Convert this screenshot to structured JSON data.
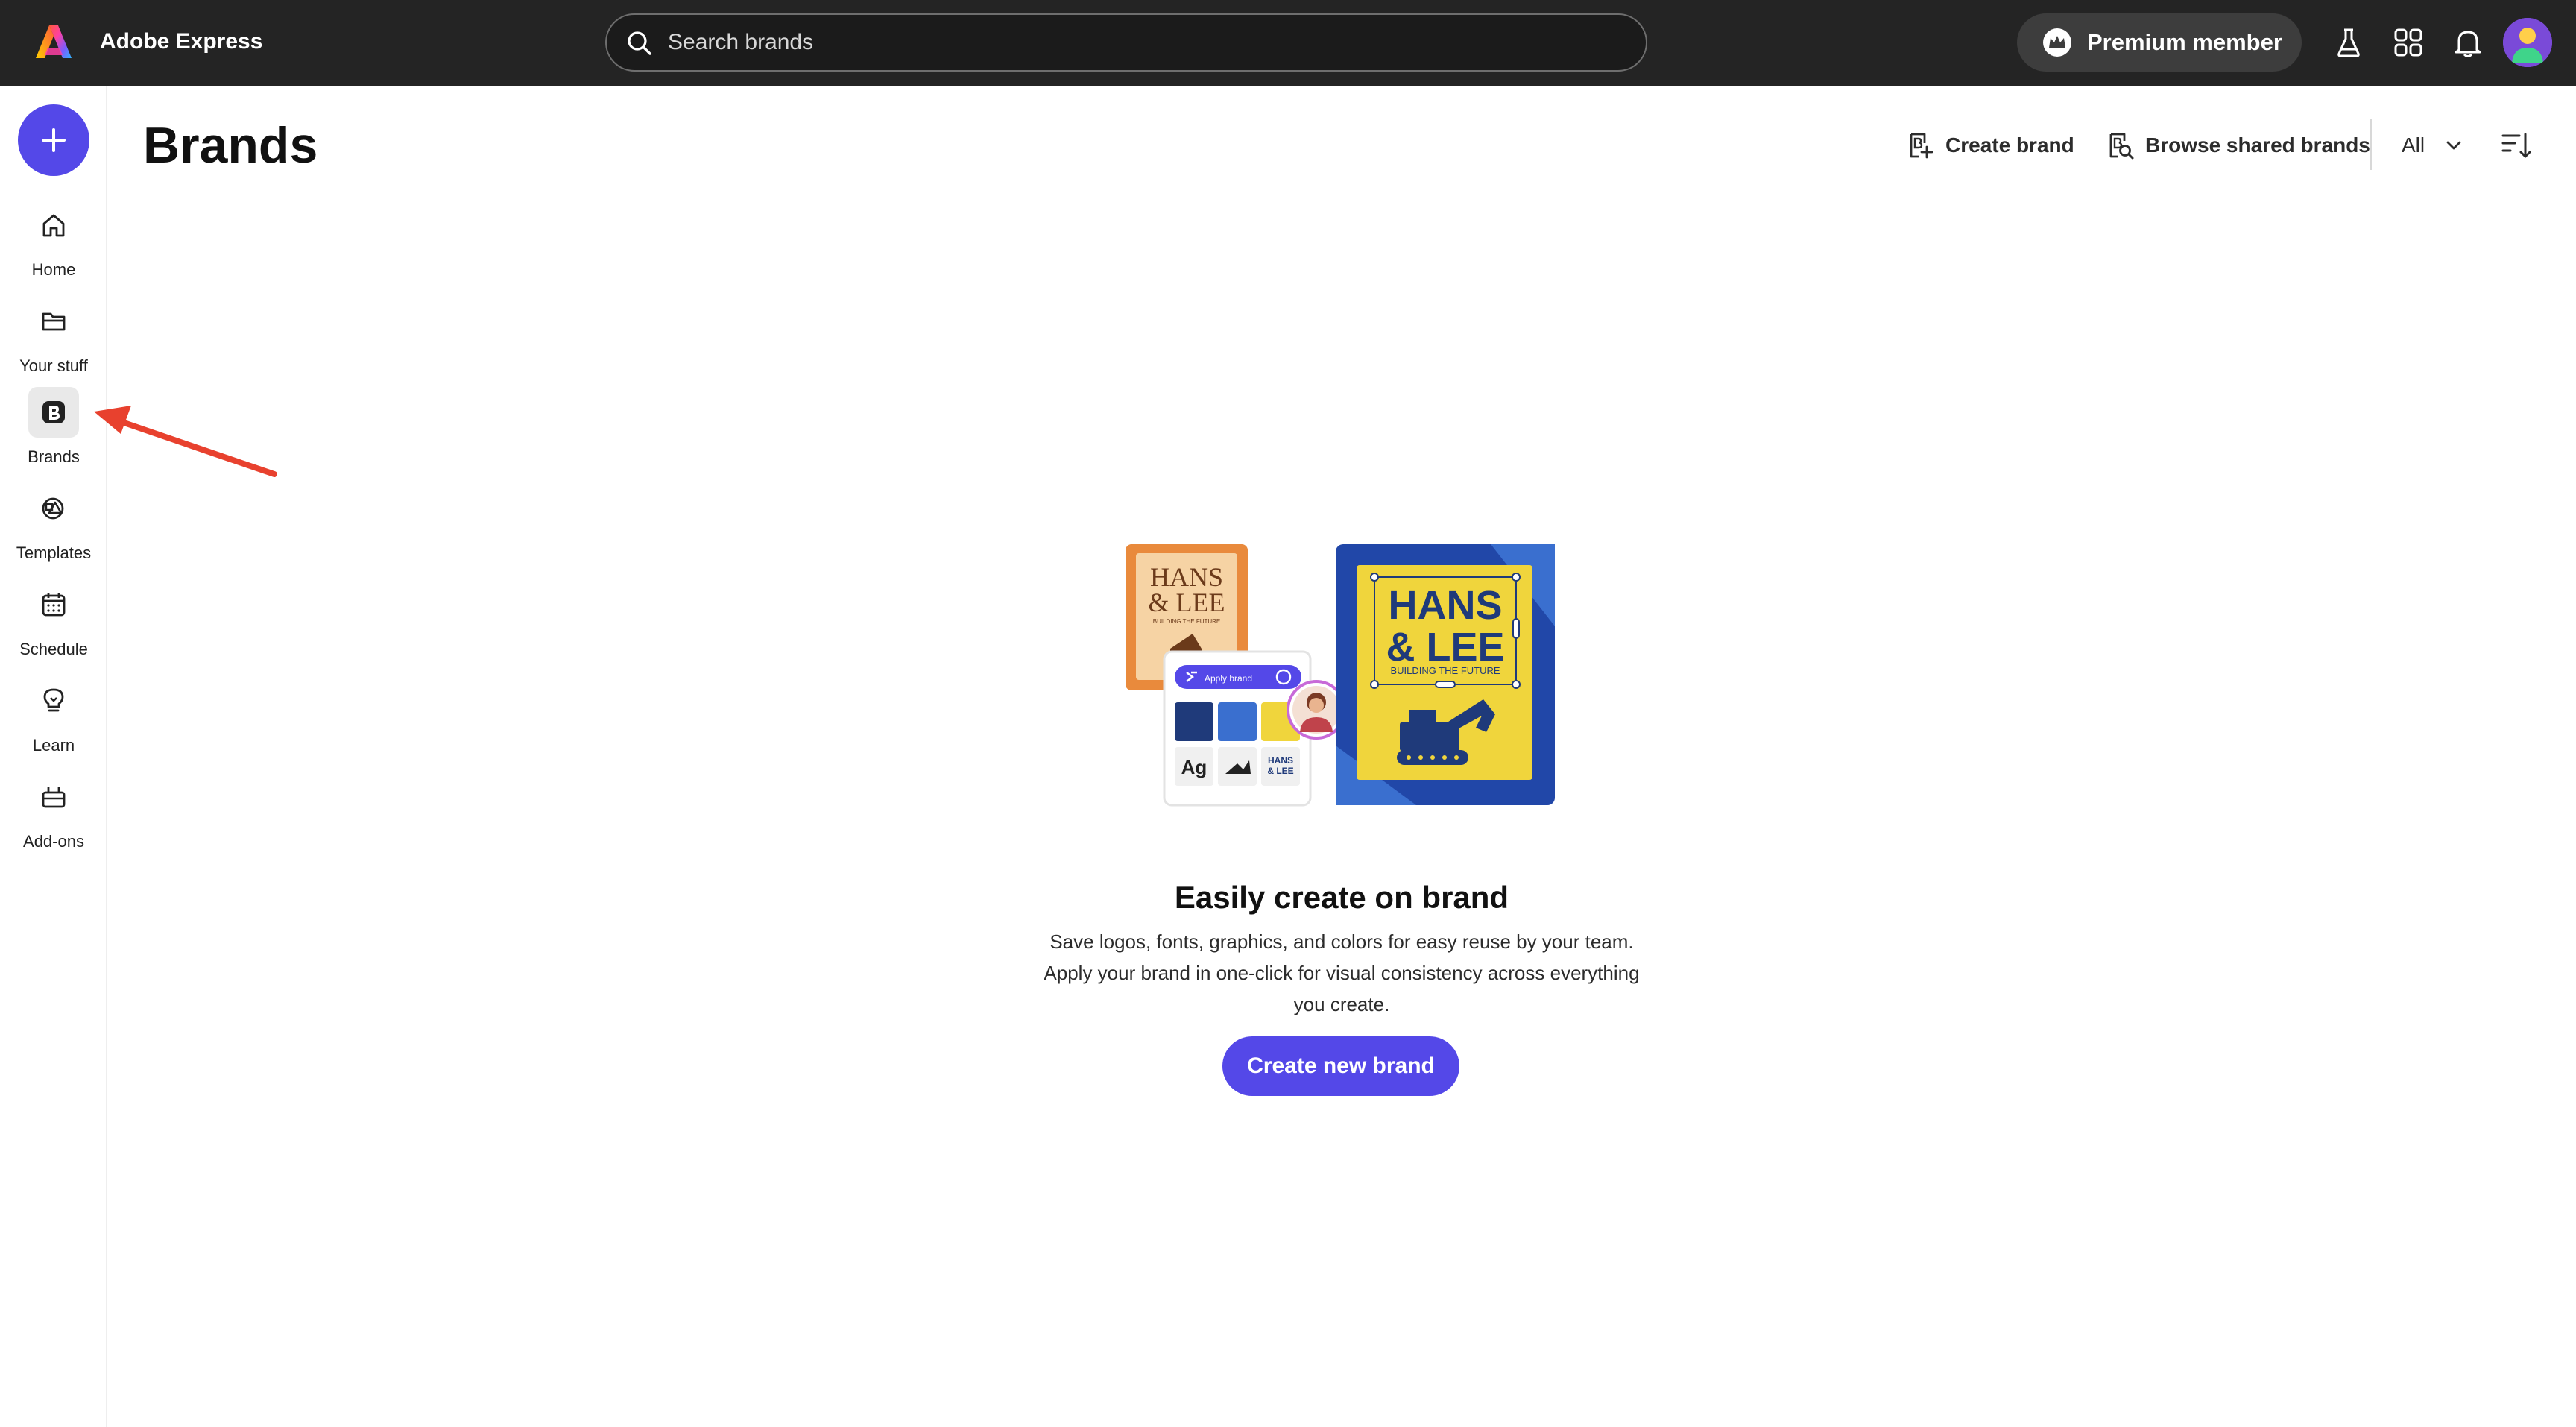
{
  "app": {
    "name": "Adobe Express"
  },
  "search": {
    "placeholder": "Search brands"
  },
  "header": {
    "premium_label": "Premium member",
    "icons": [
      "labs-icon",
      "apps-grid-icon",
      "bell-icon",
      "avatar"
    ]
  },
  "sidebar": {
    "create_icon": "plus-icon",
    "items": [
      {
        "label": "Home",
        "icon": "home-icon",
        "active": false
      },
      {
        "label": "Your stuff",
        "icon": "folder-icon",
        "active": false
      },
      {
        "label": "Brands",
        "icon": "brand-b-icon",
        "active": true
      },
      {
        "label": "Templates",
        "icon": "templates-icon",
        "active": false
      },
      {
        "label": "Schedule",
        "icon": "calendar-icon",
        "active": false
      },
      {
        "label": "Learn",
        "icon": "lightbulb-icon",
        "active": false
      },
      {
        "label": "Add-ons",
        "icon": "addons-icon",
        "active": false
      }
    ]
  },
  "main": {
    "title": "Brands",
    "actions": {
      "create_brand": "Create brand",
      "browse_shared": "Browse shared brands",
      "filter_value": "All"
    },
    "empty_state": {
      "title": "Easily create on brand",
      "description": "Save logos, fonts, graphics, and colors for easy reuse by your team. Apply your brand in one-click for visual consistency across everything you create.",
      "cta": "Create new brand"
    },
    "illustration": {
      "small_card_line1": "HANS",
      "small_card_line2": "& LEE",
      "small_card_tagline": "BUILDING THE FUTURE",
      "apply_brand_label": "Apply brand",
      "font_sample": "Ag",
      "mini_logo_line1": "HANS",
      "mini_logo_line2": "& LEE",
      "big_card_line1": "HANS",
      "big_card_line2": "& LEE",
      "big_card_tagline": "BUILDING THE FUTURE"
    }
  },
  "colors": {
    "topbar_bg": "#242424",
    "accent": "#5448e8",
    "annotation_arrow": "#e8412e",
    "brand_navy": "#1f3a7a",
    "brand_blue": "#3a6fcf",
    "brand_yellow": "#f0d53c"
  }
}
